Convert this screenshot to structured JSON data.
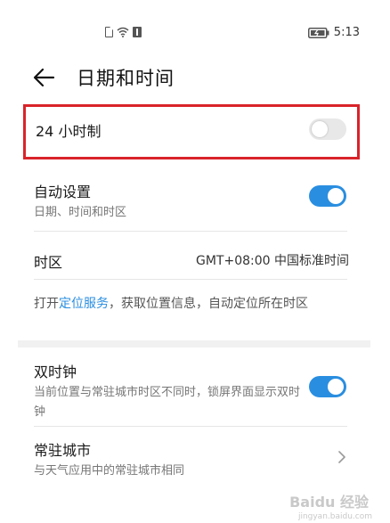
{
  "status_bar": {
    "time": "5:13",
    "icons": [
      "sim-icon",
      "wifi-icon",
      "signal-icon",
      "battery-icon"
    ]
  },
  "header": {
    "back_icon": "arrow-left-icon",
    "title": "日期和时间"
  },
  "settings": {
    "hour24": {
      "label": "24 小时制",
      "enabled": false
    },
    "auto_set": {
      "label": "自动设置",
      "sub": "日期、时间和时区",
      "enabled": true
    },
    "timezone": {
      "label": "时区",
      "value": "GMT+08:00 中国标准时间"
    },
    "location_info": {
      "prefix": "打开",
      "link": "定位服务",
      "suffix": "，获取位置信息，自动定位所在时区"
    },
    "dual_clock": {
      "label": "双时钟",
      "sub": "当前位置与常驻城市时区不同时，锁屏界面显示双时钟",
      "enabled": true
    },
    "home_city": {
      "label": "常驻城市",
      "sub": "与天气应用中的常驻城市相同"
    }
  },
  "colors": {
    "accent": "#2a8ee0",
    "highlight": "#d9232a"
  },
  "watermark": {
    "text": "Baidu 经验",
    "sub": "jingyan.baidu.com"
  }
}
